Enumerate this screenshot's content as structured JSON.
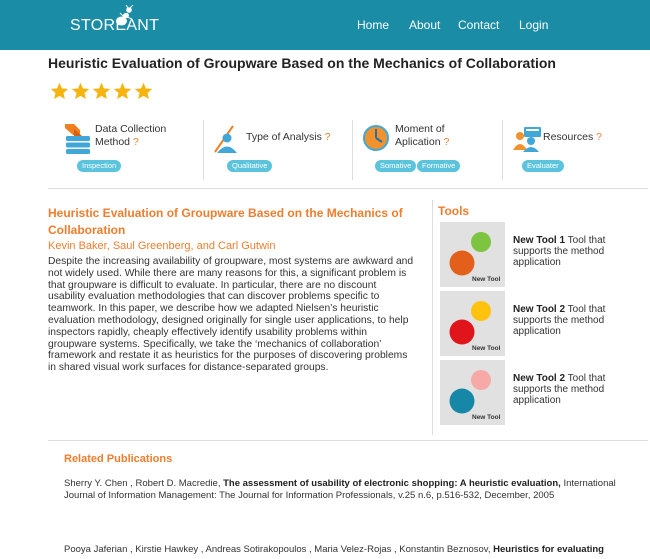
{
  "theme": {
    "primary": "#1a8ca6",
    "accent": "#ef7d2e",
    "badge": "#5bc4dc",
    "star": "#f6b40e"
  },
  "nav": {
    "logo": "STOREANT",
    "logo_icon": "ant-icon",
    "links": [
      "Home",
      "About",
      "Contact",
      "Login"
    ]
  },
  "page_title": "Heuristic Evaluation of Groupware Based on the Mechanics of Collaboration",
  "rating": {
    "stars": 5,
    "max": 5
  },
  "categories": [
    {
      "icon": "data-collection-icon",
      "lines": [
        "Data Collection",
        "Method"
      ],
      "help": "?",
      "badges": [
        "Inspection"
      ]
    },
    {
      "icon": "analysis-person-icon",
      "lines": [
        "Type of Analysis"
      ],
      "help": "?",
      "badges": [
        "Qualitative"
      ]
    },
    {
      "icon": "clock-icon",
      "lines": [
        "Moment of",
        "Aplication"
      ],
      "help": "?",
      "badges": [
        "Somative",
        "Formative"
      ]
    },
    {
      "icon": "group-icon",
      "lines": [
        "Resources"
      ],
      "help": "?",
      "badges": [
        "Evaluater"
      ]
    }
  ],
  "article": {
    "title": "Heuristic Evaluation of Groupware Based on the Mechanics of Collaboration",
    "authors": "Kevin Baker, Saul Greenberg, and Carl Gutwin",
    "abstract": "Despite the increasing availability of groupware, most systems are awkward and not widely used. While there are many reasons for this, a significant problem is that groupware is difficult to evaluate. In particular, there are no discount usability evaluation methodologies that can discover problems specific to teamwork. In this paper, we describe how we adapted Nielsen’s heuristic evaluation methodology, designed originally for single user applications, to help inspectors rapidly, cheaply effectively identify usability problems within groupware systems. Specifically, we take the ‘mechanics of collaboration’ framework and restate it as heuristics for the purposes of discovering problems in shared visual work surfaces for distance-separated groups."
  },
  "tools": {
    "heading": "Tools",
    "items": [
      {
        "name": "New Tool 1",
        "desc": "Tool that supports the method application",
        "thumb_label": "New Tool",
        "colors": [
          "#7dc540",
          "#e3601c"
        ]
      },
      {
        "name": "New Tool 2",
        "desc": "Tool that supports the method application",
        "thumb_label": "New Tool",
        "colors": [
          "#ffc20e",
          "#e0151b"
        ]
      },
      {
        "name": "New Tool 2",
        "desc": "Tool that supports the method application",
        "thumb_label": "New Tool",
        "colors": [
          "#f7a9a8",
          "#1787a8"
        ]
      }
    ]
  },
  "related": {
    "heading": "Related Publications",
    "items": [
      {
        "authors": "Sherry Y. Chen , Robert D. Macredie,",
        "title": "The assessment of usability of electronic shopping: A heuristic evaluation,",
        "venue": "International Journal of Information Management: The Journal for Information Professionals, v.25 n.6, p.516-532, December, 2005"
      },
      {
        "authors": "Pooya Jaferian , Kirstie Hawkey , Andreas Sotirakopoulos , Maria Velez-Rojas , Konstantin Beznosov,",
        "title": "Heuristics for evaluating"
      }
    ]
  }
}
